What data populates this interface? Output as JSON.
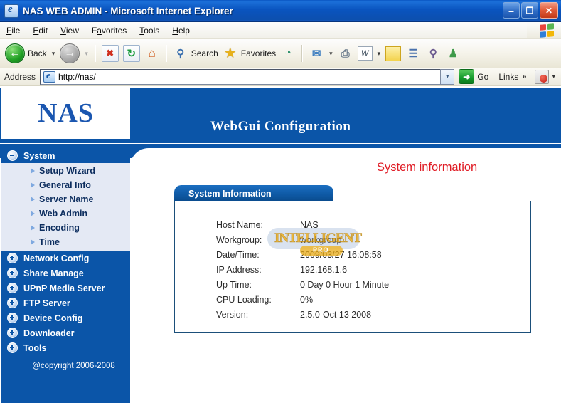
{
  "window": {
    "title": "NAS WEB ADMIN - Microsoft Internet Explorer",
    "minimize_label": "–",
    "maximize_label": "❐",
    "close_label": "✕"
  },
  "menu": {
    "items": [
      {
        "prefix": "",
        "accel": "F",
        "suffix": "ile"
      },
      {
        "prefix": "",
        "accel": "E",
        "suffix": "dit"
      },
      {
        "prefix": "",
        "accel": "V",
        "suffix": "iew"
      },
      {
        "prefix": "F",
        "accel": "a",
        "suffix": "vorites"
      },
      {
        "prefix": "",
        "accel": "T",
        "suffix": "ools"
      },
      {
        "prefix": "",
        "accel": "H",
        "suffix": "elp"
      }
    ]
  },
  "toolbar": {
    "back_label": "Back",
    "back_icon": "back-arrow-icon",
    "forward_icon": "forward-arrow-icon",
    "stop_icon": "stop-icon",
    "stop_glyph": "✖",
    "refresh_icon": "refresh-icon",
    "refresh_glyph": "↻",
    "home_icon": "home-icon",
    "home_glyph": "⌂",
    "search_label": "Search",
    "search_icon": "search-icon",
    "search_glyph": "⚲",
    "favorites_label": "Favorites",
    "favorites_icon": "star-icon",
    "favorites_glyph": "★",
    "history_icon": "history-icon",
    "history_glyph": "◔",
    "mail_icon": "mail-icon",
    "mail_glyph": "✉",
    "print_icon": "print-icon",
    "print_glyph": "⎙",
    "edit_icon": "edit-word-icon",
    "edit_glyph": "W",
    "notes_icon": "notes-icon",
    "research_icon": "research-icon",
    "research_glyph": "☰",
    "discuss_icon": "discuss-icon",
    "discuss_glyph": "⚲",
    "messenger_icon": "messenger-icon",
    "messenger_glyph": "♟",
    "caret_glyph": "▾"
  },
  "address": {
    "label": "Address",
    "value": "http://nas/",
    "placeholder": "",
    "dropdown_glyph": "▾",
    "go_label": "Go",
    "go_glyph": "➜",
    "links_label": "Links",
    "chevron_glyph": "»",
    "pdf_icon": "acrobat-icon"
  },
  "banner": {
    "logo": "NAS",
    "title": "WebGui  Configuration"
  },
  "sidebar": {
    "groups": [
      {
        "label": "System",
        "state": "expanded",
        "items": [
          {
            "label": "Setup Wizard"
          },
          {
            "label": "General Info"
          },
          {
            "label": "Server Name"
          },
          {
            "label": "Web Admin"
          },
          {
            "label": "Encoding"
          },
          {
            "label": "Time"
          }
        ]
      },
      {
        "label": "Network Config",
        "state": "collapsed",
        "items": []
      },
      {
        "label": "Share Manage",
        "state": "collapsed",
        "items": []
      },
      {
        "label": "UPnP Media Server",
        "state": "collapsed",
        "items": []
      },
      {
        "label": "FTP Server",
        "state": "collapsed",
        "items": []
      },
      {
        "label": "Device Config",
        "state": "collapsed",
        "items": []
      },
      {
        "label": "Downloader",
        "state": "collapsed",
        "items": []
      },
      {
        "label": "Tools",
        "state": "collapsed",
        "items": []
      }
    ],
    "copyright": "@copyright 2006-2008"
  },
  "main": {
    "red_title": "System information",
    "panel_tab": "System Information",
    "info": [
      {
        "key": "Host Name:",
        "value": "NAS"
      },
      {
        "key": "Workgroup:",
        "value": "workgroup"
      },
      {
        "key": "Date/Time:",
        "value": "2009/03/27 16:08:58"
      },
      {
        "key": "IP Address:",
        "value": "192.168.1.6"
      },
      {
        "key": "Up Time:",
        "value": "0 Day 0 Hour 1 Minute"
      },
      {
        "key": "CPU Loading:",
        "value": "0%"
      },
      {
        "key": "Version:",
        "value": "2.5.0-Oct 13 2008"
      }
    ]
  },
  "watermark": {
    "text": "INTELLIGENT",
    "sub": "PRO"
  },
  "colors": {
    "brand_blue": "#0b55a8",
    "accent_red": "#e01b24",
    "submenu_bg": "#e4e9f4",
    "watermark_gold": "#e8a812"
  }
}
